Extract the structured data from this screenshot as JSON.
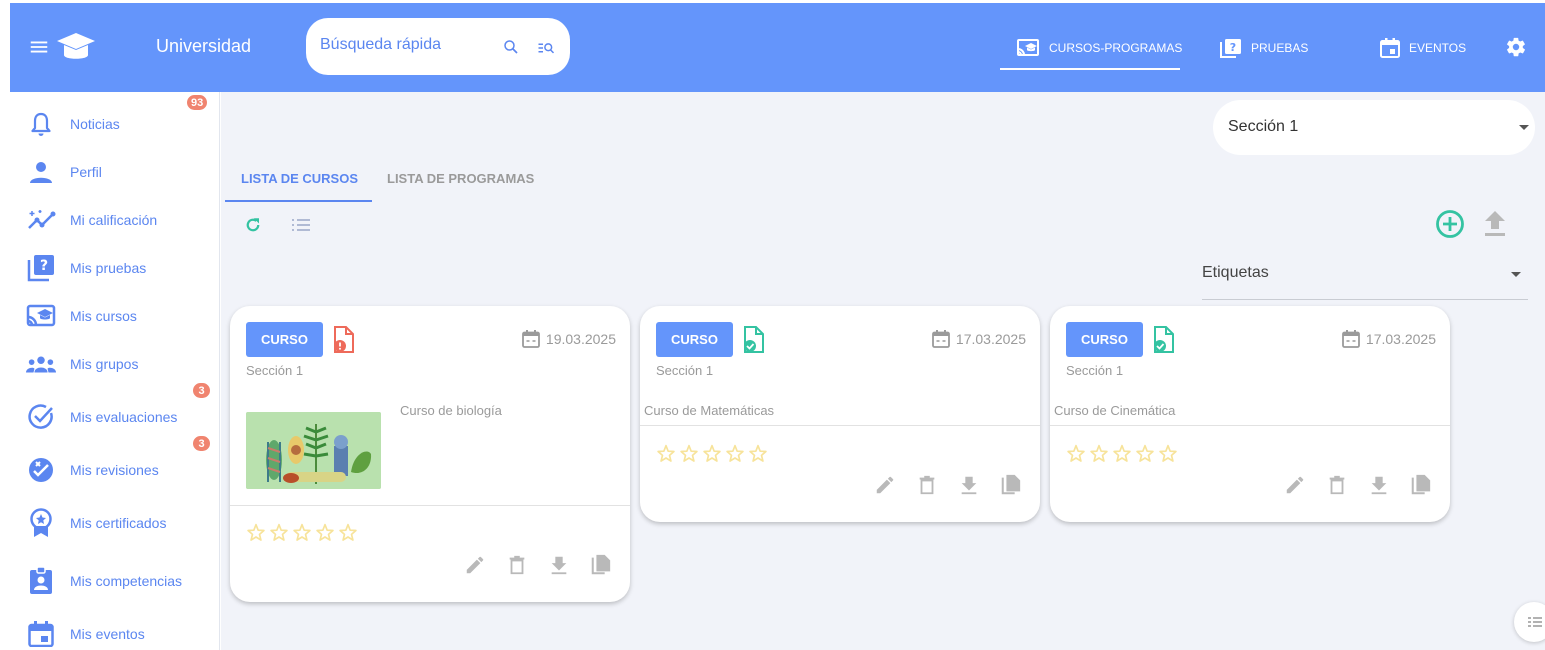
{
  "topbar": {
    "brand": "Universidad",
    "search_placeholder": "Búsqueda rápida",
    "nav": [
      {
        "label": "CURSOS-PROGRAMAS",
        "icon": "cast-school-icon",
        "active": true
      },
      {
        "label": "PRUEBAS",
        "icon": "quiz-icon",
        "active": false
      },
      {
        "label": "EVENTOS",
        "icon": "calendar-icon",
        "active": false
      }
    ]
  },
  "sidebar": {
    "items": [
      {
        "label": "Noticias",
        "icon": "bell-icon",
        "badge": "93"
      },
      {
        "label": "Perfil",
        "icon": "person-icon",
        "badge": ""
      },
      {
        "label": "Mi calificación",
        "icon": "trending-icon",
        "badge": ""
      },
      {
        "label": "Mis pruebas",
        "icon": "quiz-icon",
        "badge": ""
      },
      {
        "label": "Mis cursos",
        "icon": "cast-school-icon",
        "badge": ""
      },
      {
        "label": "Mis grupos",
        "icon": "group-icon",
        "badge": ""
      },
      {
        "label": "Mis evaluaciones",
        "icon": "check-circle-icon",
        "badge": "3"
      },
      {
        "label": "Mis revisiones",
        "icon": "review-icon",
        "badge": "3"
      },
      {
        "label": "Mis certificados",
        "icon": "award-icon",
        "badge": ""
      },
      {
        "label": "Mis competencias",
        "icon": "badge-icon",
        "badge": ""
      },
      {
        "label": "Mis eventos",
        "icon": "calendar-icon",
        "badge": ""
      }
    ]
  },
  "main": {
    "section_select": "Sección 1",
    "tabs": [
      {
        "label": "LISTA DE CURSOS",
        "active": true
      },
      {
        "label": "LISTA DE PROGRAMAS",
        "active": false
      }
    ],
    "tags_select": "Etiquetas",
    "cards": [
      {
        "type_label": "CURSO",
        "status": "error",
        "date": "19.03.2025",
        "section": "Sección 1",
        "title": "Curso de biología",
        "has_image": true,
        "rating": 0
      },
      {
        "type_label": "CURSO",
        "status": "ok",
        "date": "17.03.2025",
        "section": "Sección 1",
        "title": "Curso de Matemáticas",
        "has_image": false,
        "rating": 0
      },
      {
        "type_label": "CURSO",
        "status": "ok",
        "date": "17.03.2025",
        "section": "Sección 1",
        "title": "Curso de Cinemática",
        "has_image": false,
        "rating": 0
      }
    ]
  },
  "colors": {
    "topbar": "#6495fb",
    "accent": "#5b86f0",
    "background": "#f1f3f9",
    "badge": "#f0846f",
    "success": "#34c3a2",
    "error": "#ee6a5a",
    "star": "#f7e39a"
  }
}
